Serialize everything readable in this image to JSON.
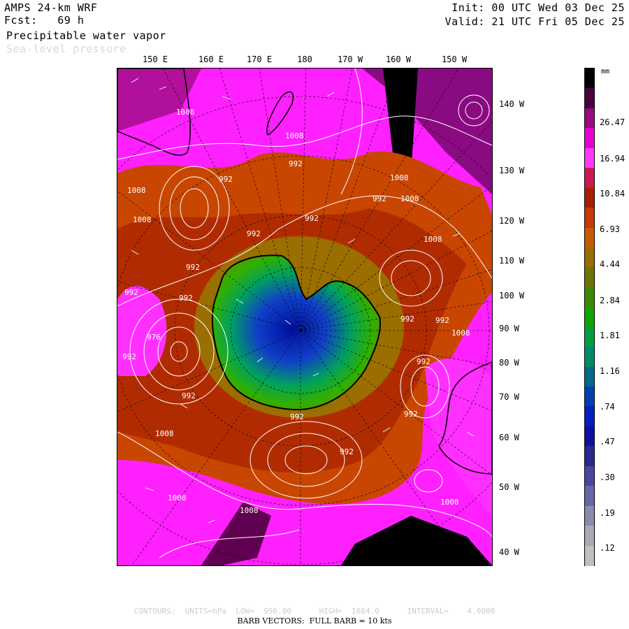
{
  "header": {
    "model": "AMPS 24-km WRF",
    "forecast": "Fcst:   69 h",
    "field1": "Precipitable water vapor",
    "field2": "Sea-level pressure",
    "init": "Init: 00 UTC Wed 03 Dec 25",
    "valid": "Valid: 21 UTC Fri 05 Dec 25"
  },
  "lon_labels": [
    "150 E",
    "160 E",
    "170 E",
    "180",
    "170 W",
    "160 W",
    "150 W"
  ],
  "lat_side_labels": [
    "140 W",
    "130 W",
    "120 W",
    "110 W",
    "100 W",
    "90 W",
    "80 W",
    "70 W",
    "60 W",
    "50 W",
    "40 W"
  ],
  "contour_labels": [
    "1008",
    "1008",
    "1008",
    "1008",
    "992",
    "992",
    "1008",
    "1008",
    "992",
    "992",
    "992",
    "992",
    "1008",
    "992",
    "976",
    "992",
    "992",
    "992",
    "992",
    "1008",
    "992",
    "992",
    "992",
    "992",
    "992",
    "1008",
    "1008",
    "1008",
    "1008"
  ],
  "legend": {
    "unit": "mm",
    "labels": [
      "26.47",
      "16.94",
      "10.84",
      "6.93",
      "4.44",
      "2.84",
      "1.81",
      "1.16",
      ".74",
      ".47",
      ".30",
      ".19",
      ".12"
    ],
    "colors": [
      "#000000",
      "#4b0040",
      "#9a0a82",
      "#e800d2",
      "#ff38ff",
      "#cc1850",
      "#a81e00",
      "#c83800",
      "#c85a00",
      "#9a6e00",
      "#6e7400",
      "#3a8a00",
      "#10a400",
      "#00a040",
      "#008a6a",
      "#006a8a",
      "#0040b0",
      "#0020c0",
      "#1010a0",
      "#282890",
      "#4848a0",
      "#6868a8",
      "#8a8ab0",
      "#a8a8b8",
      "#c0c0c0"
    ]
  },
  "footer": {
    "contours": "CONTOURS:  UNITS=hPa  LOW=  956.00      HIGH=  1084.0      INTERVAL=    4.0000",
    "barbs": "BARB VECTORS:  FULL BARB = 10 kts"
  },
  "colors": {
    "ocean_moist": "#ff20ff",
    "ocean_mid": "#c84600",
    "polar": "#0030c0",
    "ice_green": "#18a800"
  }
}
